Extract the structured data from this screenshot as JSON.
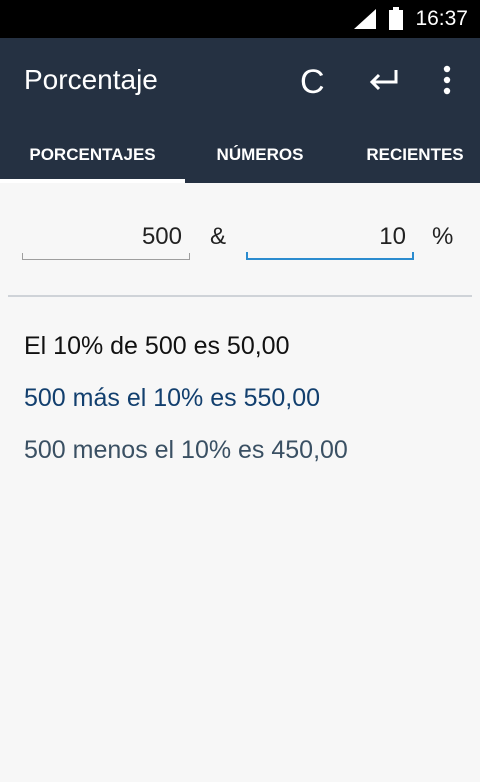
{
  "status_bar": {
    "time": "16:37",
    "icons": [
      "signal-icon",
      "battery-icon"
    ]
  },
  "app_bar": {
    "title": "Porcentaje",
    "actions": [
      "clear-icon",
      "undo-arrow-icon",
      "overflow-menu-icon"
    ],
    "clear_label": "C"
  },
  "tabs": [
    {
      "label": "PORCENTAJES",
      "selected": true
    },
    {
      "label": "NÚMEROS",
      "selected": false
    },
    {
      "label": "RECIENTES",
      "selected": false
    }
  ],
  "inputs": {
    "value": "500",
    "and_symbol": "&",
    "percent": "10",
    "percent_symbol": "%"
  },
  "results": {
    "line1": "El 10% de 500 es 50,00",
    "line2": "500 más el 10% es 550,00",
    "line3": "500 menos el 10% es 450,00"
  },
  "colors": {
    "app_bar": "#253142",
    "accent": "#2b8ccf",
    "result_dark": "#111111",
    "result_blue": "#123f6e",
    "result_slate": "#3a5063"
  }
}
